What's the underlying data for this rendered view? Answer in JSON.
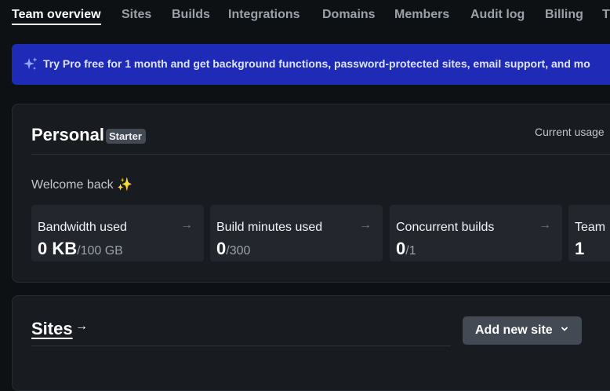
{
  "nav": {
    "items": [
      {
        "label": "Team overview",
        "active": true
      },
      {
        "label": "Sites"
      },
      {
        "label": "Builds"
      },
      {
        "label": "Integrations"
      },
      {
        "label": "Domains"
      },
      {
        "label": "Members"
      },
      {
        "label": "Audit log"
      },
      {
        "label": "Billing"
      },
      {
        "label": "T"
      }
    ]
  },
  "banner": {
    "icon": "sparkles-icon",
    "text": "Try Pro free for 1 month and get background functions, password-protected sites, email support, and mo"
  },
  "team": {
    "title": "Personal",
    "plan": "Starter",
    "usage_label": "Current usage",
    "welcome": "Welcome back ✨",
    "tiles": [
      {
        "label": "Bandwidth used",
        "value": "0 KB",
        "limit": "/100 GB"
      },
      {
        "label": "Build minutes used",
        "value": "0",
        "limit": "/300"
      },
      {
        "label": "Concurrent builds",
        "value": "0",
        "limit": "/1"
      },
      {
        "label": "Team",
        "value": "1",
        "limit": ""
      }
    ]
  },
  "sites": {
    "title": "Sites",
    "add_button": "Add new site"
  },
  "colors": {
    "banner_bg": "#1f2ab6",
    "page_bg": "#0e1114",
    "card_bg": "#181b20",
    "tile_bg": "#23272d",
    "button_bg": "#434a53"
  }
}
